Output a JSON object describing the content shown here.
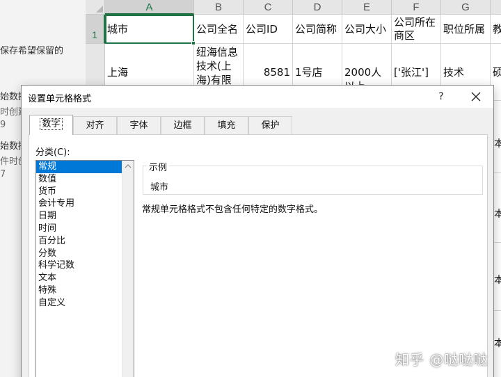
{
  "left_pane": {
    "lines": [
      "保存希望保留的",
      "始数据",
      "时创建",
      "9",
      "始数据",
      "件时创",
      "7"
    ]
  },
  "sheet": {
    "columns": [
      "A",
      "B",
      "C",
      "D",
      "E",
      "F",
      "G"
    ],
    "rows": [
      {
        "num": "1",
        "cells": [
          "城市",
          "公司全名",
          "公司ID",
          "公司简称",
          "公司大小",
          "公司所在商区",
          "职位所属",
          "教"
        ]
      },
      {
        "num": "",
        "cells": [
          "上海",
          "纽海信息技术(上海)有限",
          "8581",
          "1号店",
          "2000人以上",
          "['张江']",
          "技术",
          "硕"
        ]
      }
    ],
    "right_edge": [
      "本",
      "本",
      "本",
      "本"
    ]
  },
  "dialog": {
    "title": "设置单元格格式",
    "help_label": "?",
    "tabs": [
      "数字",
      "对齐",
      "字体",
      "边框",
      "填充",
      "保护"
    ],
    "active_tab": "数字",
    "category_label": "分类(C):",
    "categories": [
      "常规",
      "数值",
      "货币",
      "会计专用",
      "日期",
      "时间",
      "百分比",
      "分数",
      "科学记数",
      "文本",
      "特殊",
      "自定义"
    ],
    "selected_category": "常规",
    "sample_label": "示例",
    "sample_value": "城市",
    "description": "常规单元格格式不包含任何特定的数字格式。"
  },
  "watermark": "知乎 @哒哒哒",
  "colors": {
    "excel_green": "#217346",
    "selection_blue": "#0078d7",
    "dialog_bg": "#f0f0f0"
  },
  "icons": [
    "close-icon",
    "scroll-up-arrow-icon",
    "select-all-triangle-icon"
  ]
}
